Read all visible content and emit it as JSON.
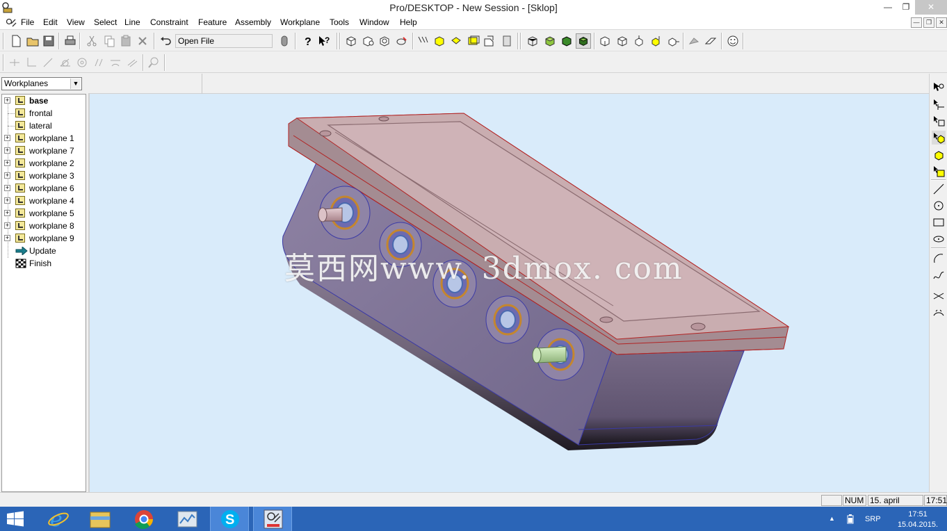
{
  "window": {
    "title": "Pro/DESKTOP - New Session - [Sklop]",
    "min": "—",
    "max": "❐",
    "close": "✕"
  },
  "menu": [
    "File",
    "Edit",
    "View",
    "Select",
    "Line",
    "Constraint",
    "Feature",
    "Assembly",
    "Workplane",
    "Tools",
    "Window",
    "Help"
  ],
  "mdi": {
    "min": "—",
    "restore": "❐",
    "close": "✕"
  },
  "toolbar": {
    "open_file_label": "Open File"
  },
  "left_panel": {
    "combo_value": "Workplanes",
    "combo_arrow": "▼",
    "tree": [
      {
        "label": "base",
        "bold": true,
        "expandable": true
      },
      {
        "label": "frontal",
        "bold": false,
        "expandable": false
      },
      {
        "label": "lateral",
        "bold": false,
        "expandable": false
      },
      {
        "label": "workplane 1",
        "bold": false,
        "expandable": true
      },
      {
        "label": "workplane 7",
        "bold": false,
        "expandable": true
      },
      {
        "label": "workplane 2",
        "bold": false,
        "expandable": true
      },
      {
        "label": "workplane 3",
        "bold": false,
        "expandable": true
      },
      {
        "label": "workplane 6",
        "bold": false,
        "expandable": true
      },
      {
        "label": "workplane 4",
        "bold": false,
        "expandable": true
      },
      {
        "label": "workplane 5",
        "bold": false,
        "expandable": true
      },
      {
        "label": "workplane 8",
        "bold": false,
        "expandable": true
      },
      {
        "label": "workplane 9",
        "bold": false,
        "expandable": true
      }
    ],
    "update_label": "Update",
    "finish_label": "Finish"
  },
  "viewport": {
    "watermark": "莫西网www. 3dmox. com",
    "colors": {
      "background": "#d9ebfa",
      "lid": "#c9adb0",
      "body": "#8a7a96",
      "edge": "#b22222"
    }
  },
  "status": {
    "num": "NUM",
    "date": "15. april 2015.",
    "time": "17:51"
  },
  "taskbar": {
    "lang": "SRP",
    "time": "17:51",
    "date": "15.04.2015.",
    "apps": [
      "windows-start",
      "internet-explorer",
      "file-explorer",
      "chrome",
      "task-manager",
      "skype",
      "pro-desktop"
    ]
  }
}
